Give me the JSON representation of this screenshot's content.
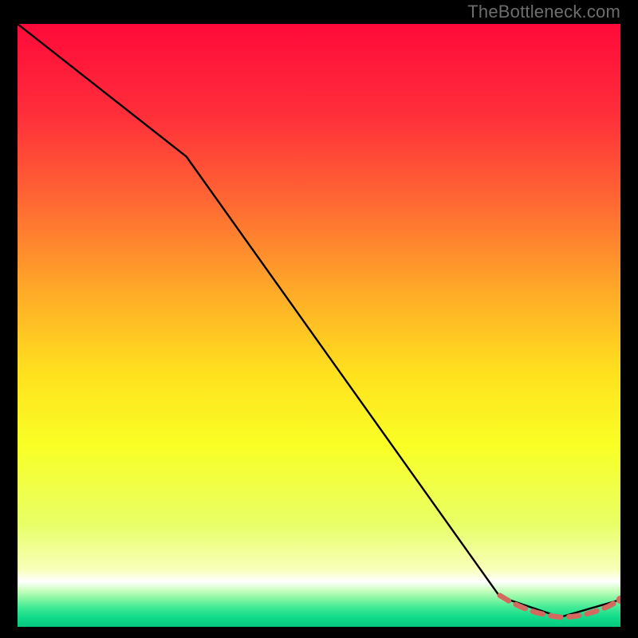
{
  "attribution": "TheBottleneck.com",
  "colors": {
    "frame_bg": "#000000",
    "attribution_text": "#6d6d6d",
    "line_stroke": "#000000",
    "dash_stroke": "#d46a5f",
    "dot_fill": "#d46a5f",
    "gradient_stops": [
      {
        "offset": 0.0,
        "color": "#ff0a3a"
      },
      {
        "offset": 0.15,
        "color": "#ff2e3a"
      },
      {
        "offset": 0.3,
        "color": "#ff6a33"
      },
      {
        "offset": 0.45,
        "color": "#ffad27"
      },
      {
        "offset": 0.58,
        "color": "#ffe11e"
      },
      {
        "offset": 0.7,
        "color": "#f9ff25"
      },
      {
        "offset": 0.83,
        "color": "#e8ff67"
      },
      {
        "offset": 0.905,
        "color": "#f8ffba"
      },
      {
        "offset": 0.925,
        "color": "#ffffff"
      },
      {
        "offset": 0.938,
        "color": "#d0ffc4"
      },
      {
        "offset": 0.952,
        "color": "#8cf7a5"
      },
      {
        "offset": 0.967,
        "color": "#45eb96"
      },
      {
        "offset": 0.983,
        "color": "#13dc8b"
      },
      {
        "offset": 1.0,
        "color": "#06c97f"
      }
    ]
  },
  "chart_data": {
    "type": "line",
    "title": "",
    "xlabel": "",
    "ylabel": "",
    "xlim": [
      0,
      100
    ],
    "ylim": [
      0,
      100
    ],
    "grid": false,
    "series": [
      {
        "name": "curve",
        "style": "solid",
        "x": [
          0,
          28,
          80,
          90,
          100
        ],
        "values": [
          100,
          78,
          5,
          1.6,
          4.5
        ]
      },
      {
        "name": "dashed-overlay",
        "style": "dashed",
        "x": [
          80,
          82,
          84,
          86,
          88,
          90,
          92,
          94,
          96,
          98,
          100
        ],
        "values": [
          5.2,
          4.0,
          3.1,
          2.4,
          1.9,
          1.6,
          1.7,
          2.0,
          2.6,
          3.4,
          4.5
        ]
      }
    ],
    "dots": {
      "name": "endpoints",
      "x": [
        100
      ],
      "values": [
        4.5
      ]
    }
  }
}
